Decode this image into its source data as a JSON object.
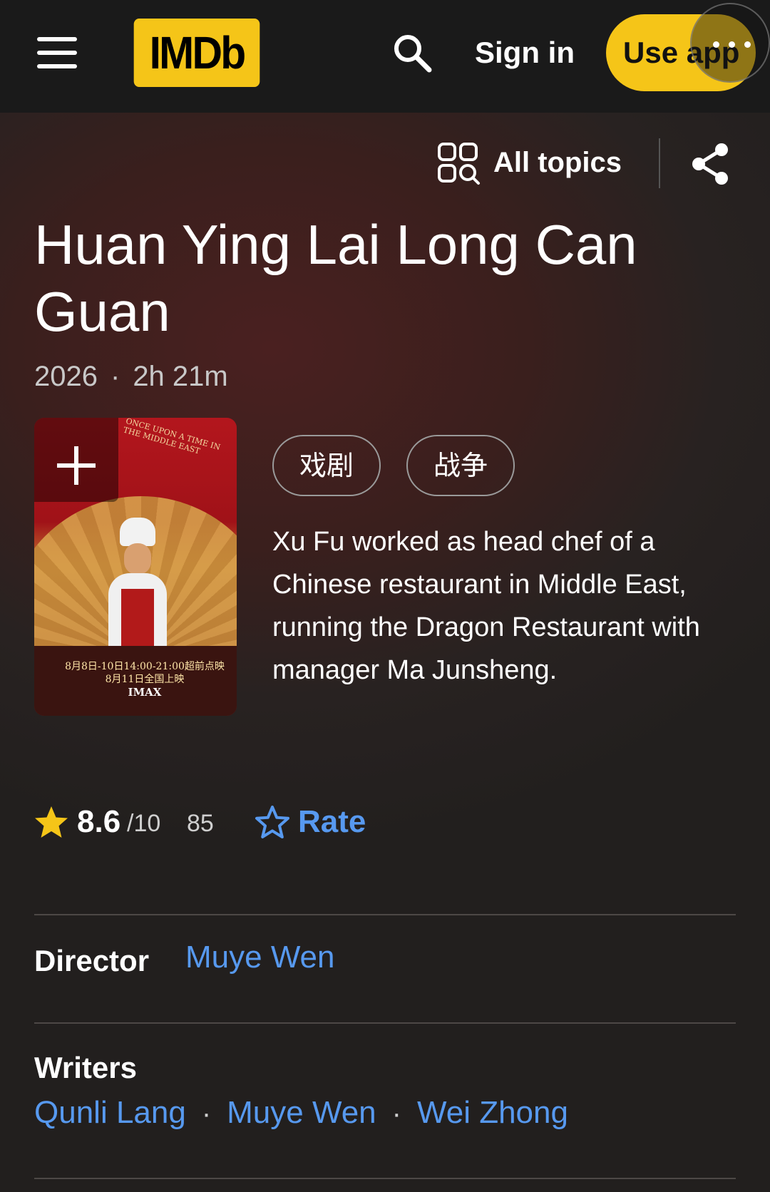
{
  "header": {
    "logo": "IMDb",
    "sign_in_label": "Sign in",
    "use_app_label": "Use app",
    "icons": [
      "menu-icon",
      "search-icon",
      "more-dots-icon"
    ],
    "brand_color": "#f5c518"
  },
  "subnav": {
    "all_topics_label": "All topics",
    "icons": [
      "all-topics-icon",
      "share-icon"
    ]
  },
  "title": {
    "name": "Huan Ying Lai Long Can Guan",
    "year": "2026",
    "separator": "·",
    "runtime": "2h 21m"
  },
  "poster": {
    "top_line": "ONCE UPON A TIME IN THE MIDDLE EAST",
    "release_line_1": "8月8日-10日14:00-21:00超前点映",
    "release_line_2": "8月11日全国上映",
    "imax_label": "IMAX"
  },
  "genres": [
    "戏剧",
    "战争"
  ],
  "plot": "Xu Fu worked as head chef of a Chinese restaurant in Middle East, running the Dragon Restaurant with manager Ma Junsheng.",
  "rating": {
    "value": "8.6",
    "max": "/10",
    "count": "85",
    "rate_label": "Rate",
    "star_color": "#f5c518",
    "link_color": "#5799ef"
  },
  "credits": {
    "director_label": "Director",
    "director": "Muye Wen",
    "writers_label": "Writers",
    "writers": [
      "Qunli Lang",
      "Muye Wen",
      "Wei Zhong"
    ],
    "separator": "·"
  }
}
